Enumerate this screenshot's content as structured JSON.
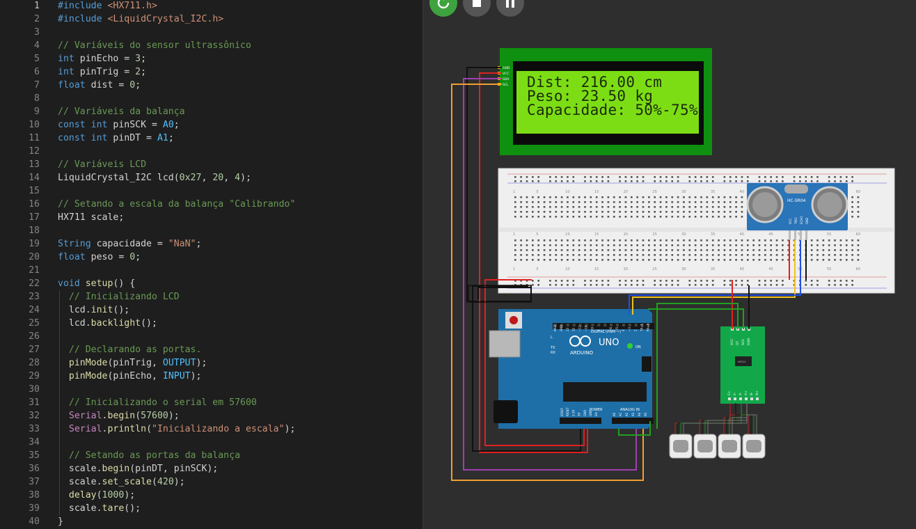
{
  "editor": {
    "lines": [
      {
        "n": "1",
        "tokens": [
          {
            "t": "#include ",
            "c": "pp"
          },
          {
            "t": "<HX711.h>",
            "c": "inc"
          }
        ]
      },
      {
        "n": "2",
        "tokens": [
          {
            "t": "#include ",
            "c": "pp"
          },
          {
            "t": "<LiquidCrystal_I2C.h>",
            "c": "inc"
          }
        ]
      },
      {
        "n": "3",
        "tokens": []
      },
      {
        "n": "4",
        "tokens": [
          {
            "t": "// Variáveis do sensor ultrassônico",
            "c": "cm"
          }
        ]
      },
      {
        "n": "5",
        "tokens": [
          {
            "t": "int",
            "c": "kw"
          },
          {
            "t": " pinEcho = ",
            "c": "tx"
          },
          {
            "t": "3",
            "c": "num"
          },
          {
            "t": ";",
            "c": "tx"
          }
        ]
      },
      {
        "n": "6",
        "tokens": [
          {
            "t": "int",
            "c": "kw"
          },
          {
            "t": " pinTrig = ",
            "c": "tx"
          },
          {
            "t": "2",
            "c": "num"
          },
          {
            "t": ";",
            "c": "tx"
          }
        ]
      },
      {
        "n": "7",
        "tokens": [
          {
            "t": "float",
            "c": "kw"
          },
          {
            "t": " dist = ",
            "c": "tx"
          },
          {
            "t": "0",
            "c": "num"
          },
          {
            "t": ";",
            "c": "tx"
          }
        ]
      },
      {
        "n": "8",
        "tokens": []
      },
      {
        "n": "9",
        "tokens": [
          {
            "t": "// Variáveis da balança",
            "c": "cm"
          }
        ]
      },
      {
        "n": "10",
        "tokens": [
          {
            "t": "const",
            "c": "kw"
          },
          {
            "t": " ",
            "c": "tx"
          },
          {
            "t": "int",
            "c": "kw"
          },
          {
            "t": " pinSCK = ",
            "c": "tx"
          },
          {
            "t": "A0",
            "c": "const"
          },
          {
            "t": ";",
            "c": "tx"
          }
        ]
      },
      {
        "n": "11",
        "tokens": [
          {
            "t": "const",
            "c": "kw"
          },
          {
            "t": " ",
            "c": "tx"
          },
          {
            "t": "int",
            "c": "kw"
          },
          {
            "t": " pinDT = ",
            "c": "tx"
          },
          {
            "t": "A1",
            "c": "const"
          },
          {
            "t": ";",
            "c": "tx"
          }
        ]
      },
      {
        "n": "12",
        "tokens": []
      },
      {
        "n": "13",
        "tokens": [
          {
            "t": "// Variáveis LCD",
            "c": "cm"
          }
        ]
      },
      {
        "n": "14",
        "tokens": [
          {
            "t": "LiquidCrystal_I2C lcd(",
            "c": "tx"
          },
          {
            "t": "0x27",
            "c": "num"
          },
          {
            "t": ", ",
            "c": "tx"
          },
          {
            "t": "20",
            "c": "num"
          },
          {
            "t": ", ",
            "c": "tx"
          },
          {
            "t": "4",
            "c": "num"
          },
          {
            "t": ");",
            "c": "tx"
          }
        ]
      },
      {
        "n": "15",
        "tokens": []
      },
      {
        "n": "16",
        "tokens": [
          {
            "t": "// Setando a escala da balança \"Calibrando\"",
            "c": "cm"
          }
        ]
      },
      {
        "n": "17",
        "tokens": [
          {
            "t": "HX711 scale;",
            "c": "tx"
          }
        ]
      },
      {
        "n": "18",
        "tokens": []
      },
      {
        "n": "19",
        "tokens": [
          {
            "t": "String",
            "c": "kw"
          },
          {
            "t": " capacidade = ",
            "c": "tx"
          },
          {
            "t": "\"NaN\"",
            "c": "str"
          },
          {
            "t": ";",
            "c": "tx"
          }
        ]
      },
      {
        "n": "20",
        "tokens": [
          {
            "t": "float",
            "c": "kw"
          },
          {
            "t": " peso = ",
            "c": "tx"
          },
          {
            "t": "0",
            "c": "num"
          },
          {
            "t": ";",
            "c": "tx"
          }
        ]
      },
      {
        "n": "21",
        "tokens": []
      },
      {
        "n": "22",
        "tokens": [
          {
            "t": "void",
            "c": "kw"
          },
          {
            "t": " ",
            "c": "tx"
          },
          {
            "t": "setup",
            "c": "fn"
          },
          {
            "t": "() {",
            "c": "tx"
          }
        ]
      },
      {
        "n": "23",
        "tokens": [
          {
            "t": "  // Inicializando LCD",
            "c": "cm"
          }
        ]
      },
      {
        "n": "24",
        "tokens": [
          {
            "t": "  lcd.",
            "c": "tx"
          },
          {
            "t": "init",
            "c": "fn"
          },
          {
            "t": "();",
            "c": "tx"
          }
        ]
      },
      {
        "n": "25",
        "tokens": [
          {
            "t": "  lcd.",
            "c": "tx"
          },
          {
            "t": "backlight",
            "c": "fn"
          },
          {
            "t": "();",
            "c": "tx"
          }
        ]
      },
      {
        "n": "26",
        "tokens": []
      },
      {
        "n": "27",
        "tokens": [
          {
            "t": "  // Declarando as portas.",
            "c": "cm"
          }
        ]
      },
      {
        "n": "28",
        "tokens": [
          {
            "t": "  ",
            "c": "tx"
          },
          {
            "t": "pinMode",
            "c": "fn"
          },
          {
            "t": "(pinTrig, ",
            "c": "tx"
          },
          {
            "t": "OUTPUT",
            "c": "const"
          },
          {
            "t": ");",
            "c": "tx"
          }
        ]
      },
      {
        "n": "29",
        "tokens": [
          {
            "t": "  ",
            "c": "tx"
          },
          {
            "t": "pinMode",
            "c": "fn"
          },
          {
            "t": "(pinEcho, ",
            "c": "tx"
          },
          {
            "t": "INPUT",
            "c": "const"
          },
          {
            "t": ");",
            "c": "tx"
          }
        ]
      },
      {
        "n": "30",
        "tokens": []
      },
      {
        "n": "31",
        "tokens": [
          {
            "t": "  // Inicializando o serial em 57600",
            "c": "cm"
          }
        ]
      },
      {
        "n": "32",
        "tokens": [
          {
            "t": "  ",
            "c": "tx"
          },
          {
            "t": "Serial",
            "c": "serial"
          },
          {
            "t": ".",
            "c": "tx"
          },
          {
            "t": "begin",
            "c": "fn"
          },
          {
            "t": "(",
            "c": "tx"
          },
          {
            "t": "57600",
            "c": "num"
          },
          {
            "t": ");",
            "c": "tx"
          }
        ]
      },
      {
        "n": "33",
        "tokens": [
          {
            "t": "  ",
            "c": "tx"
          },
          {
            "t": "Serial",
            "c": "serial"
          },
          {
            "t": ".",
            "c": "tx"
          },
          {
            "t": "println",
            "c": "fn"
          },
          {
            "t": "(",
            "c": "tx"
          },
          {
            "t": "\"Inicializando a escala\"",
            "c": "str"
          },
          {
            "t": ");",
            "c": "tx"
          }
        ]
      },
      {
        "n": "34",
        "tokens": []
      },
      {
        "n": "35",
        "tokens": [
          {
            "t": "  // Setando as portas da balança",
            "c": "cm"
          }
        ]
      },
      {
        "n": "36",
        "tokens": [
          {
            "t": "  scale.",
            "c": "tx"
          },
          {
            "t": "begin",
            "c": "fn"
          },
          {
            "t": "(pinDT, pinSCK);",
            "c": "tx"
          }
        ]
      },
      {
        "n": "37",
        "tokens": [
          {
            "t": "  scale.",
            "c": "tx"
          },
          {
            "t": "set_scale",
            "c": "fn"
          },
          {
            "t": "(",
            "c": "tx"
          },
          {
            "t": "420",
            "c": "num"
          },
          {
            "t": ");",
            "c": "tx"
          }
        ]
      },
      {
        "n": "38",
        "tokens": [
          {
            "t": "  ",
            "c": "tx"
          },
          {
            "t": "delay",
            "c": "fn"
          },
          {
            "t": "(",
            "c": "tx"
          },
          {
            "t": "1000",
            "c": "num"
          },
          {
            "t": ");",
            "c": "tx"
          }
        ]
      },
      {
        "n": "39",
        "tokens": [
          {
            "t": "  scale.",
            "c": "tx"
          },
          {
            "t": "tare",
            "c": "fn"
          },
          {
            "t": "();",
            "c": "tx"
          }
        ]
      },
      {
        "n": "40",
        "tokens": [
          {
            "t": "}",
            "c": "tx"
          }
        ]
      }
    ]
  },
  "simulator": {
    "controls": {
      "restart_icon": "restart-icon",
      "stop_icon": "stop-icon",
      "pause_icon": "pause-icon"
    },
    "lcd": {
      "line1": "Dist: 216.00 cm",
      "line2": "Peso: 23.50 kg",
      "line3": "Capacidade: 50%-75%",
      "pins": [
        "GND",
        "VCC",
        "SDA",
        "SCL"
      ]
    },
    "breadboard": {
      "col_labels": [
        "1",
        "5",
        "10",
        "15",
        "20",
        "25",
        "30",
        "35",
        "40",
        "45",
        "50",
        "55",
        "60"
      ]
    },
    "ultrasonic": {
      "label": "HC-SR04",
      "pins": [
        "VCC",
        "TRIG",
        "ECHO",
        "GND"
      ]
    },
    "arduino": {
      "brand": "ARDUINO",
      "model": "UNO",
      "on_label": "ON",
      "tx": "TX",
      "rx": "RX",
      "l": "L",
      "digital_label": "DIGITAL (PWM ~)",
      "digital_pins": [
        "AREF",
        "GND",
        "13",
        "12",
        "~11",
        "~10",
        "~9",
        "8",
        "7",
        "~6",
        "~5",
        "4",
        "~3",
        "2",
        "TX→1",
        "RX←0"
      ],
      "power_label": "POWER",
      "analog_label": "ANALOG IN",
      "power_pins": [
        "IOREF",
        "RESET",
        "3.3V",
        "5V",
        "GND",
        "GND",
        "Vin"
      ],
      "analog_pins": [
        "A0",
        "A1",
        "A2",
        "A3",
        "A4",
        "A5"
      ]
    },
    "hx711": {
      "label": "HX711",
      "pins_top": [
        "VCC",
        "DT",
        "SCK",
        "GND"
      ],
      "pins_bottom": [
        "E+",
        "E-",
        "A-",
        "A+",
        "B-",
        "B+"
      ]
    },
    "colors": {
      "wire_red": "#e02020",
      "wire_black": "#111111",
      "wire_yellow": "#f0c020",
      "wire_blue": "#2050e0",
      "wire_green": "#20a020",
      "wire_purple": "#a040b0",
      "wire_orange": "#f0a030",
      "lcd_green": "#7cdd15",
      "pcb_green": "#109010",
      "arduino_blue": "#1e6fa8",
      "sensor_blue": "#2a74b8",
      "hx_green": "#12a84a"
    }
  }
}
